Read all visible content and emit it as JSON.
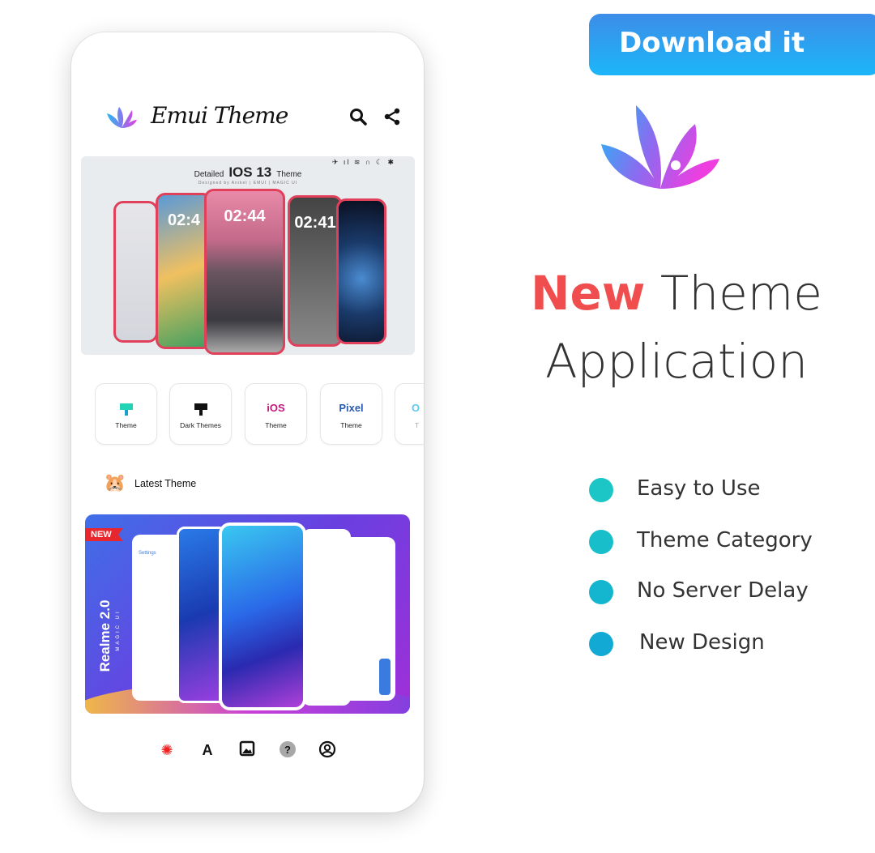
{
  "promo": {
    "download_button": "Download it Now",
    "headline_accent": "New",
    "headline_rest": "Theme",
    "headline_line2": "Application",
    "features": [
      "Easy to Use",
      "Theme Category",
      "No Server Delay",
      "New Design"
    ],
    "accent_color": "#f04e4e",
    "bullet_color": "#12b8cc"
  },
  "app": {
    "title": "Emui Theme",
    "header_icons": [
      "search-icon",
      "share-icon"
    ],
    "featured_banner": {
      "prefix": "Detailed",
      "name": "IOS 13",
      "suffix": "Theme",
      "credit": "Designed by Aniket | EMUI | MAGIC UI",
      "status_icons": "✈ ıl ≋ ∩ ☾ ✱",
      "clocks": [
        "02:4",
        "02:44",
        "02:41"
      ]
    },
    "categories": [
      {
        "icon": "paint-brush-teal",
        "label": "Theme"
      },
      {
        "icon": "paint-brush-black",
        "label": "Dark Themes"
      },
      {
        "icon_text": "iOS",
        "label": "Theme"
      },
      {
        "icon_text": "Pixel",
        "label": "Theme"
      },
      {
        "icon_text": "O",
        "label": "T"
      }
    ],
    "latest_section": "Latest Theme",
    "latest_banner": {
      "badge": "NEW",
      "title": "Realme 2.0",
      "subtitle": "MAGIC UI",
      "settings_label": "Settings"
    },
    "bottom_nav": [
      "home-icon",
      "font-icon",
      "wallpaper-icon",
      "help-icon",
      "profile-icon"
    ]
  }
}
